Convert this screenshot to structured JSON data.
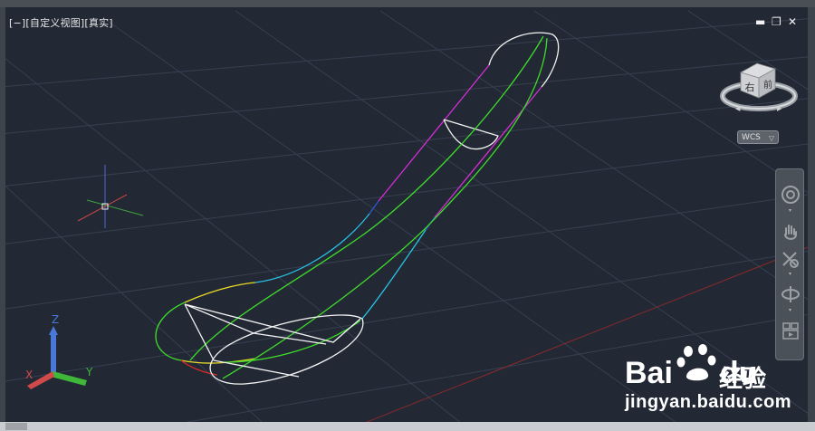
{
  "viewport": {
    "label": "[−][自定义视图][真实]",
    "background": "#222834",
    "controls": {
      "minimize": "▬",
      "restore": "❐",
      "close": "✕"
    }
  },
  "navcube": {
    "face_right": "右",
    "face_front": "前"
  },
  "wcs": {
    "label": "WCS",
    "arrow": "▽"
  },
  "ucs_icon": {
    "axis_z": "Z",
    "axis_y": "Y",
    "axis_x": "X"
  },
  "navigation_bar": {
    "tools": [
      "steering-wheel-icon",
      "pan-hand-icon",
      "zoom-extents-icon",
      "orbit-icon",
      "showmotion-icon"
    ]
  },
  "watermark": {
    "brand_left": "Bai",
    "brand_right": "du",
    "brand_cn": "经验",
    "url": "jingyan.baidu.com"
  },
  "colors": {
    "grid": "#384050",
    "green": "#3fdc2b",
    "magenta": "#d42fd8",
    "cyan": "#27c3e6",
    "yellow": "#e6d92a",
    "red": "#d42a2a",
    "white": "#f2f2f2",
    "blue": "#2a58d9"
  }
}
